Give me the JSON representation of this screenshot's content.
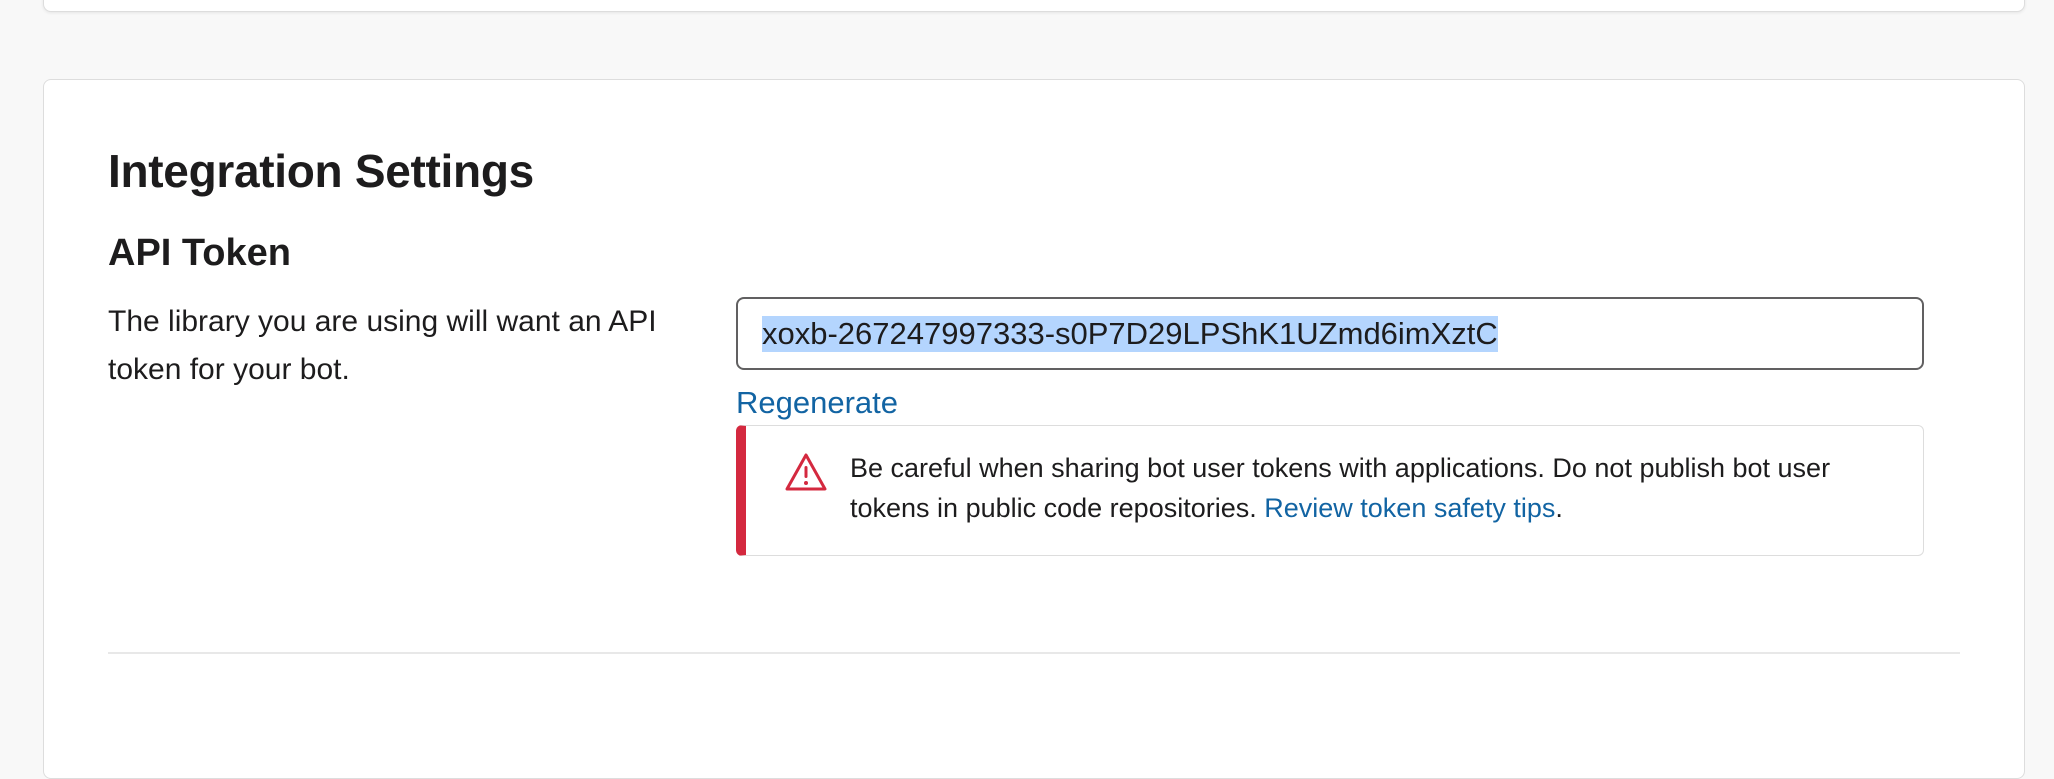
{
  "integration": {
    "title": "Integration Settings",
    "api_token": {
      "heading": "API Token",
      "description": "The library you are using will want an API token for your bot.",
      "value": "xoxb-267247997333-s0P7D29LPShK1UZmd6imXztC",
      "regenerate_label": "Regenerate",
      "warning": {
        "icon": "warning-triangle-icon",
        "text": "Be careful when sharing bot user tokens with applications. Do not publish bot user tokens in public code repositories.",
        "link_label": "Review token safety tips",
        "trailing": ".",
        "accent_color": "#d4293f"
      }
    }
  },
  "colors": {
    "link": "#1264a3",
    "selection": "#b4d5fe",
    "warning_accent": "#d4293f"
  }
}
